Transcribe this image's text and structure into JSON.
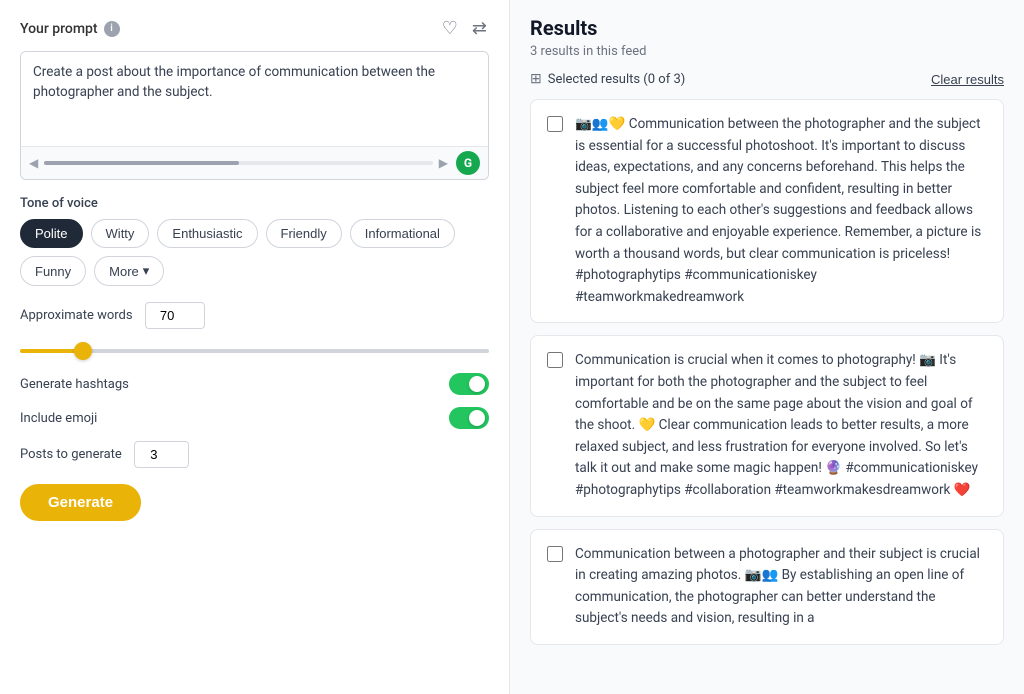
{
  "left": {
    "prompt_title": "Your prompt",
    "prompt_text": "Create a post about the importance of communication between the photographer and the subject.",
    "tone_label": "Tone of voice",
    "tones": [
      {
        "id": "polite",
        "label": "Polite",
        "active": true
      },
      {
        "id": "witty",
        "label": "Witty",
        "active": false
      },
      {
        "id": "enthusiastic",
        "label": "Enthusiastic",
        "active": false
      },
      {
        "id": "friendly",
        "label": "Friendly",
        "active": false
      },
      {
        "id": "informational",
        "label": "Informational",
        "active": false
      },
      {
        "id": "funny",
        "label": "Funny",
        "active": false
      },
      {
        "id": "more",
        "label": "More",
        "active": false,
        "has_arrow": true
      }
    ],
    "approx_words_label": "Approximate words",
    "approx_words_value": "70",
    "slider_value": 12,
    "generate_hashtags_label": "Generate hashtags",
    "include_emoji_label": "Include emoji",
    "posts_to_generate_label": "Posts to generate",
    "posts_to_generate_value": "3",
    "generate_btn_label": "Generate"
  },
  "right": {
    "results_title": "Results",
    "results_count": "3 results in this feed",
    "selected_results_label": "Selected results (0 of 3)",
    "clear_results_label": "Clear results",
    "results": [
      {
        "id": 1,
        "text": "📷👥💛 Communication between the photographer and the subject is essential for a successful photoshoot. It's important to discuss ideas, expectations, and any concerns beforehand. This helps the subject feel more comfortable and confident, resulting in better photos. Listening to each other's suggestions and feedback allows for a collaborative and enjoyable experience. Remember, a picture is worth a thousand words, but clear communication is priceless! #photographytips #communicationiskey #teamworkmakedreamwork"
      },
      {
        "id": 2,
        "text": "Communication is crucial when it comes to photography! 📷 It's important for both the photographer and the subject to feel comfortable and be on the same page about the vision and goal of the shoot. 💛 Clear communication leads to better results, a more relaxed subject, and less frustration for everyone involved. So let's talk it out and make some magic happen! 🔮 #communicationiskey #photographytips #collaboration #teamworkmakesdreamwork ❤️"
      },
      {
        "id": 3,
        "text": "Communication between a photographer and their subject is crucial in creating amazing photos. 📷👥 By establishing an open line of communication, the photographer can better understand the subject's needs and vision, resulting in a"
      }
    ]
  }
}
